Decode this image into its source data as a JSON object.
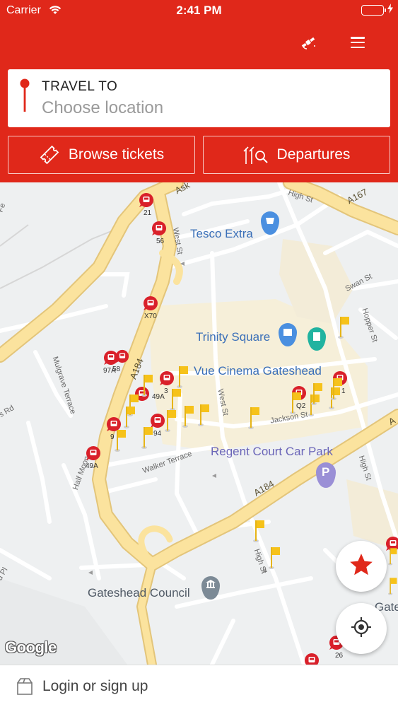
{
  "status_bar": {
    "carrier": "Carrier",
    "time": "2:41 PM",
    "battery_color": "#4cd964"
  },
  "header": {
    "background": "#e0281a",
    "icons": [
      "satellite-icon",
      "menu-icon"
    ],
    "travel_to": {
      "label": "TRAVEL TO",
      "placeholder": "Choose location",
      "icon": "location-pin-icon"
    },
    "buttons": {
      "browse": {
        "label": "Browse tickets",
        "icon": "ticket-icon"
      },
      "departures": {
        "label": "Departures",
        "icon": "bus-stop-search-icon"
      }
    }
  },
  "map": {
    "pois": {
      "tesco": "Tesco Extra",
      "trinity": "Trinity Square",
      "cinema": "Vue Cinema Gateshead",
      "regent": "Regent Court Car Park",
      "council": "Gateshead Council",
      "gate_partial": "Gate"
    },
    "roads": {
      "a167": "A167",
      "a184_main": "A184",
      "a184_south": "A184",
      "a1_partial": "A",
      "ask_partial": "Ask",
      "high_st_n": "High St",
      "high_st_e": "High St",
      "high_st_s": "High St",
      "west_st_n": "West St",
      "west_st_s": "West St",
      "swan_st": "Swan St",
      "hopper_st": "Hopper St",
      "jackson_st": "Jackson St",
      "walker_terrace": "Walker Terrace",
      "mulgrave_terrace": "Mulgrave Terrace",
      "half_moon": "Half Moon",
      "rd_partial": "s Rd",
      "pl_partial": "d Pl",
      "edge_partial": "Fe"
    },
    "bus_stops": [
      "21",
      "56",
      "X70",
      "97A",
      "58",
      "3",
      "49A",
      "94",
      "9",
      "49A",
      "Q2",
      "1",
      "26"
    ],
    "google_logo": "Google",
    "accent_red": "#e0281a",
    "flag_color": "#f6c21a"
  },
  "fabs": {
    "favourites": "star-icon",
    "my_location": "crosshair-icon"
  },
  "bottom_bar": {
    "label": "Login or sign up",
    "icon": "bag-icon"
  }
}
